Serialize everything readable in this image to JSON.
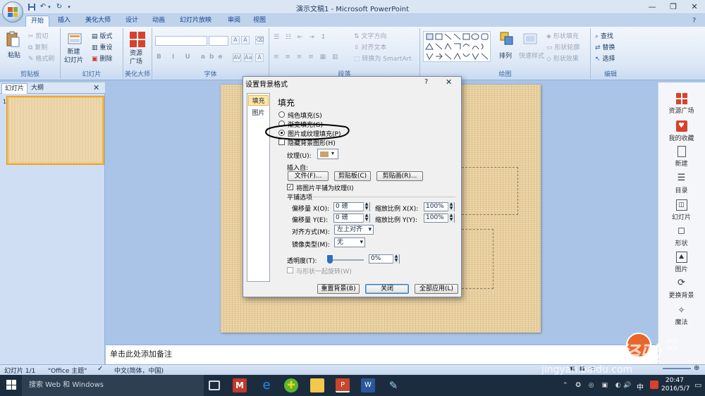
{
  "window": {
    "title": "演示文稿1 - Microsoft PowerPoint",
    "controls": [
      "—",
      "❐",
      "✕"
    ]
  },
  "quick_access": [
    "save-icon",
    "undo-icon",
    "redo-icon",
    "customize-icon"
  ],
  "tabs": [
    "开始",
    "插入",
    "美化大师",
    "设计",
    "动画",
    "幻灯片放映",
    "审阅",
    "视图"
  ],
  "ribbon": {
    "clipboard": {
      "label": "剪贴板",
      "paste": "粘贴",
      "cut": "剪切",
      "copy": "复制",
      "format_painter": "格式刷"
    },
    "slides": {
      "label": "幻灯片",
      "new_slide": "新建\n幻灯片",
      "layout": "版式",
      "reset": "重设",
      "delete": "删除"
    },
    "beautify": {
      "label": "美化大师",
      "resource": "资源\n广场"
    },
    "font": {
      "label": "字体"
    },
    "paragraph": {
      "label": "段落",
      "text_direction": "文字方向",
      "align_text": "对齐文本",
      "convert_smartart": "转换为 SmartArt"
    },
    "drawing": {
      "label": "绘图",
      "arrange": "排列",
      "quick_styles": "快速样式",
      "shape_fill": "形状填充",
      "shape_outline": "形状轮廓",
      "shape_effects": "形状效果"
    },
    "editing": {
      "label": "编辑",
      "find": "查找",
      "replace": "替换",
      "select": "选择"
    }
  },
  "left_panel": {
    "tab_slides": "幻灯片",
    "tab_outline": "大纲",
    "slide_number": "1"
  },
  "notes": {
    "placeholder": "单击此处添加备注"
  },
  "status_bar": {
    "slide_info": "幻灯片 1/1",
    "theme": "\"Office 主题\"",
    "language": "中文(简体，中国)"
  },
  "right_sidebar": [
    "资源广场",
    "我的收藏",
    "新建",
    "目录",
    "幻灯片",
    "形状",
    "图片",
    "更换背景",
    "魔法"
  ],
  "dialog": {
    "title": "设置背景格式",
    "help": "?",
    "close": "✕",
    "nav": [
      "填充",
      "图片"
    ],
    "section_title": "填充",
    "options": [
      "纯色填充(S)",
      "渐变填充(G)",
      "图片或纹理填充(P)"
    ],
    "selected_option": 2,
    "hide_background": "隐藏背景图形(H)",
    "texture_label": "纹理(U):",
    "insert_from": "插入自:",
    "btn_file": "文件(F)...",
    "btn_clipboard": "剪贴板(C)",
    "btn_clipart": "剪贴画(R)...",
    "tile_checkbox": "将图片平铺为纹理(I)",
    "tile_options": "平铺选项",
    "offset_x_label": "偏移量 X(O):",
    "offset_x_value": "0 磅",
    "offset_y_label": "偏移量 Y(E):",
    "offset_y_value": "0 磅",
    "scale_x_label": "缩放比例 X(X):",
    "scale_x_value": "100%",
    "scale_y_label": "缩放比例 Y(Y):",
    "scale_y_value": "100%",
    "alignment_label": "对齐方式(M):",
    "alignment_value": "左上对齐",
    "mirror_label": "镜像类型(M):",
    "mirror_value": "无",
    "transparency_label": "透明度(T):",
    "transparency_value": "0%",
    "rotate_with_shape": "与形状一起旋转(W)",
    "btn_reset": "重置背景(B)",
    "btn_close": "关闭",
    "btn_apply_all": "全部应用(L)"
  },
  "taskbar": {
    "search": "搜索 Web 和 Windows",
    "time": "20:47",
    "date": "2016/5/7",
    "ime": "中"
  },
  "watermark": {
    "text": "Baidu 经验",
    "url": "jingyan.baidu.com",
    "speed_up": "0K/s",
    "speed_down": "0K/s"
  }
}
